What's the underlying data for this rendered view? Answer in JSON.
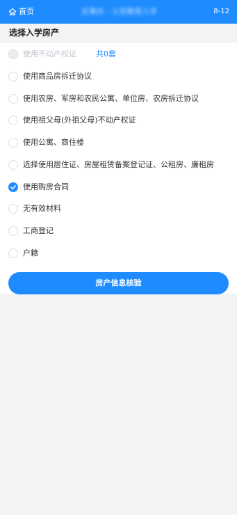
{
  "header": {
    "home_label": "首页",
    "title": "实事办 · 义务教育入学服务",
    "date": "8-12"
  },
  "section_title": "选择入学房产",
  "options": [
    {
      "label": "使用不动产权证",
      "state": "disabled",
      "count": "共0套"
    },
    {
      "label": "使用商品房拆迁协议",
      "state": "unchecked"
    },
    {
      "label": "使用农房、军房和农民公寓、单位房、农房拆迁协议",
      "state": "unchecked"
    },
    {
      "label": "使用祖父母(外祖父母)不动产权证",
      "state": "unchecked"
    },
    {
      "label": "使用公寓、商住楼",
      "state": "unchecked"
    },
    {
      "label": "选择使用居住证、房屋租赁备案登记证、公租房、廉租房",
      "state": "unchecked"
    },
    {
      "label": "使用购房合同",
      "state": "checked"
    },
    {
      "label": "无有效材料",
      "state": "unchecked"
    },
    {
      "label": "工商登记",
      "state": "unchecked"
    },
    {
      "label": "户籍",
      "state": "unchecked"
    }
  ],
  "verify_button": "房产信息核验",
  "colors": {
    "primary": "#1e8cff",
    "background": "#f2f3f5"
  },
  "icons": {
    "home": "home-icon",
    "check": "check-icon"
  }
}
